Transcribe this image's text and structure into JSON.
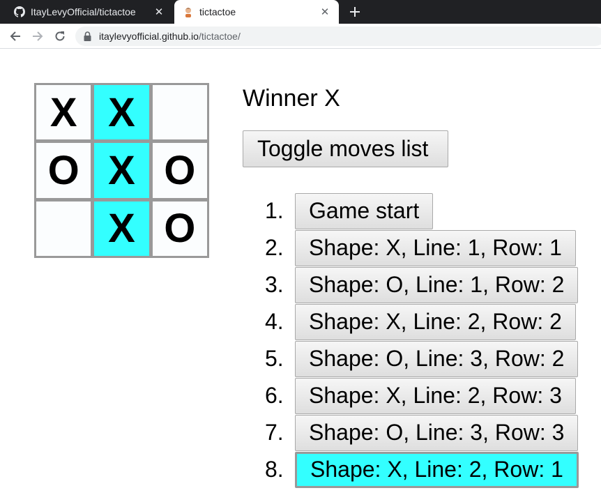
{
  "browser": {
    "tabs": [
      {
        "title": "ItayLevyOfficial/tictactoe",
        "icon": "github-icon",
        "active": false
      },
      {
        "title": "tictactoe",
        "icon": "avatar-icon",
        "active": true
      }
    ],
    "url_host": "itaylevyofficial.github.io",
    "url_path": "/tictactoe/"
  },
  "game": {
    "status": "Winner X",
    "board": [
      "X",
      "X",
      "",
      "O",
      "X",
      "O",
      "",
      "X",
      "O"
    ],
    "winning_cells": [
      1,
      4,
      7
    ],
    "win_color": "#33ffff",
    "toggle_label": "Toggle moves list",
    "moves": [
      {
        "num": "1.",
        "label": "Game start"
      },
      {
        "num": "2.",
        "label": "Shape: X, Line: 1, Row: 1"
      },
      {
        "num": "3.",
        "label": "Shape: O, Line: 1, Row: 2"
      },
      {
        "num": "4.",
        "label": "Shape: X, Line: 2, Row: 2"
      },
      {
        "num": "5.",
        "label": "Shape: O, Line: 3, Row: 2"
      },
      {
        "num": "6.",
        "label": "Shape: X, Line: 2, Row: 3"
      },
      {
        "num": "7.",
        "label": "Shape: O, Line: 3, Row: 3"
      },
      {
        "num": "8.",
        "label": "Shape: X, Line: 2, Row: 1"
      }
    ],
    "current_move": 8
  }
}
